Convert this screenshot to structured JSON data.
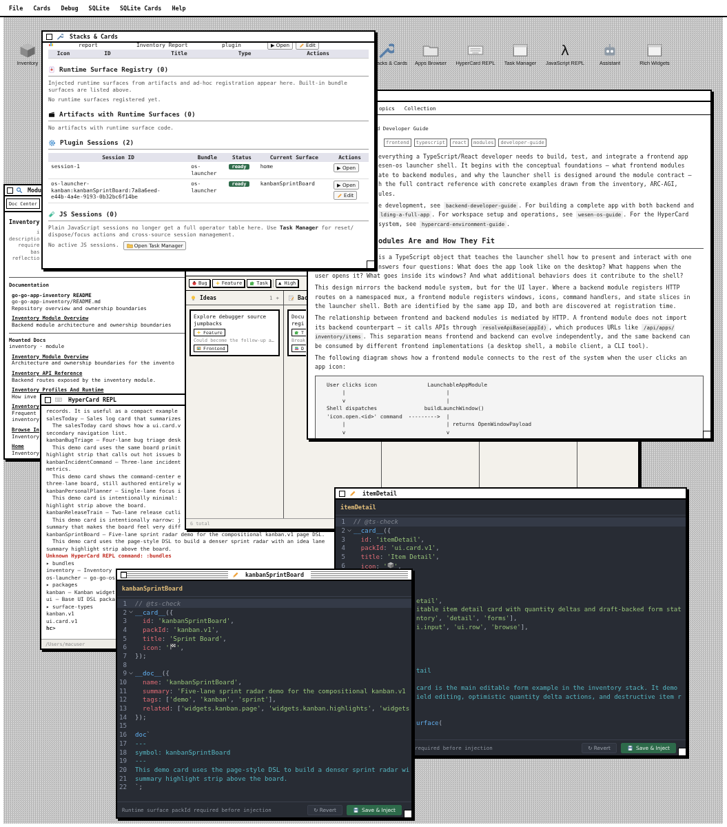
{
  "menu_bar": [
    {
      "label": "File"
    },
    {
      "label": "Cards"
    },
    {
      "label": "Debug"
    },
    {
      "label": "SQLite"
    },
    {
      "label": "SQLite Cards"
    },
    {
      "label": "Help"
    }
  ],
  "desktop_icons": [
    {
      "label": "Inventory",
      "kind": "box"
    },
    {
      "label": "acks & Cards",
      "kind": "wrench"
    },
    {
      "label": "Apps Browser",
      "kind": "folder"
    },
    {
      "label": "HyperCard REPL",
      "kind": "keyboard"
    },
    {
      "label": "Task Manager",
      "kind": "window"
    },
    {
      "label": "JavaScript REPL",
      "kind": "glyph",
      "glyph": "λ"
    },
    {
      "label": "Assistant",
      "kind": "robot"
    },
    {
      "label": "Rich Widgets",
      "kind": "window"
    }
  ],
  "module_window": {
    "title": "Modu",
    "active": false,
    "search": "Doc Center",
    "heading": "Inventory",
    "summary": "i\ndescriptio\nrequire\nbas\nreflectio",
    "sections": [
      {
        "title": "Documentation",
        "entries": [
          {
            "title": "go-go-app-inventory README",
            "link": false,
            "path": "go-go-app-inventory/README.md",
            "desc": "Repository overview and ownership boundaries"
          },
          {
            "title": "Inventory Module Overview",
            "link": true,
            "desc": "Backend module architecture and ownership boundaries"
          }
        ]
      },
      {
        "title": "Mounted Docs",
        "subtitle": "inventory · module",
        "entries": [
          {
            "title": "Inventory Module Overview",
            "link": true,
            "desc": "Architecture and ownership boundaries for the invento"
          },
          {
            "title": "Inventory API Reference",
            "link": true,
            "desc": "Backend routes exposed by the inventory module."
          },
          {
            "title": "Inventory Profiles And Runtime",
            "link": true,
            "desc": "How inve"
          },
          {
            "title": "Inventory",
            "link": true,
            "desc": "Frequent\ninventory"
          },
          {
            "title": "Browse In",
            "link": true,
            "desc": "Inventory"
          },
          {
            "title": "Home",
            "link": true,
            "desc": "Inventory"
          }
        ]
      }
    ]
  },
  "repl_window": {
    "title": "HyperCard REPL",
    "active": false,
    "lines": [
      {
        "kind": "text",
        "text": "records. It is useful as a compact example"
      },
      {
        "kind": "text",
        "text": "salesToday — Sales log card that summarizes"
      },
      {
        "kind": "text",
        "text": "  The salesToday card shows how a ui.card.v"
      },
      {
        "kind": "text",
        "text": "secondary navigation list."
      },
      {
        "kind": "text",
        "text": "kanbanBugTriage — Four-lane bug triage desk"
      },
      {
        "kind": "text",
        "text": "  This demo card uses the same board primit"
      },
      {
        "kind": "text",
        "text": "highlight strip that calls out hot issues b"
      },
      {
        "kind": "text",
        "text": "kanbanIncidentCommand — Three-lane incident"
      },
      {
        "kind": "text",
        "text": "metrics."
      },
      {
        "kind": "text",
        "text": "  This demo card shows the command-center e"
      },
      {
        "kind": "text",
        "text": "three-lane board, still authored entirely w"
      },
      {
        "kind": "text",
        "text": "kanbanPersonalPlanner — Single-lane focus i"
      },
      {
        "kind": "text",
        "text": "  This demo card is intentionally minimal:"
      },
      {
        "kind": "text",
        "text": "highlight strip above the board."
      },
      {
        "kind": "text",
        "text": "kanbanReleaseTrain — Two-lane release cutli"
      },
      {
        "kind": "text",
        "text": "  This demo card is intentionally narrow: j"
      },
      {
        "kind": "text",
        "text": "summary that makes the board feel very diff"
      },
      {
        "kind": "text",
        "text": "kanbanSprintBoard — Five-lane sprint radar demo for the compositional kanban.v1 page DSL."
      },
      {
        "kind": "text",
        "text": "  This demo card uses the page-style DSL to build a denser sprint radar with an idea lane"
      },
      {
        "kind": "text",
        "text": "summary highlight strip above the board."
      },
      {
        "kind": "error",
        "text": "Unknown HyperCard REPL command: :bundles"
      },
      {
        "kind": "text",
        "text": "▸ bundles"
      },
      {
        "kind": "text",
        "text": "inventory — Inventory"
      },
      {
        "kind": "text",
        "text": "os-launcher — go-go-os"
      },
      {
        "kind": "text",
        "text": "▸ packages"
      },
      {
        "kind": "text",
        "text": "kanban — Kanban widget"
      },
      {
        "kind": "text",
        "text": "ui — Base UI DSL packa"
      },
      {
        "kind": "text",
        "text": "▸ surface-types"
      },
      {
        "kind": "text",
        "text": "kanban.v1"
      },
      {
        "kind": "text",
        "text": "ui.card.v1"
      },
      {
        "kind": "prompt",
        "text": "hc>"
      }
    ],
    "footer": "/Users/macuser"
  },
  "kanban_window": {
    "filters": [
      {
        "label": "Bug",
        "kind": "bug"
      },
      {
        "label": "Feature",
        "kind": "sparkle"
      },
      {
        "label": "Task",
        "kind": "puzzle"
      },
      {
        "label": "▲ High",
        "kind": "text"
      }
    ],
    "lanes": [
      {
        "title": "Ideas",
        "kind": "bulb",
        "count": "1",
        "add": "+",
        "cards": [
          {
            "title": "Explore debugger source jumpbacks",
            "tags": [
              {
                "label": "Feature",
                "kind": "sparkle"
              }
            ],
            "note": "Could become the follow-up a…",
            "extra_tags": [
              {
                "label": "Frontend",
                "kind": "frame"
              }
            ]
          }
        ]
      },
      {
        "title": "Bac",
        "kind": "notepad",
        "cards": [
          {
            "title": "Docu\nregi",
            "tags": [
              {
                "label": "T",
                "kind": "puzzle"
              }
            ],
            "note": "Break",
            "extra_tags": [
              {
                "label": "D",
                "kind": "books"
              }
            ]
          }
        ]
      }
    ],
    "footer": "6 total"
  },
  "doc_window": {
    "active": false,
    "tabs": [
      {
        "label": "opics",
        "selected": false
      },
      {
        "label": "Collection",
        "selected": false
      }
    ],
    "subtitle": "d Developer Guide",
    "tags": [
      "frontend",
      "typescript",
      "react",
      "modules",
      "developer-guide"
    ],
    "upper": [
      [
        {
          "kind": "text",
          "text": "everything a TypeScript/React developer needs to build, test, and integrate a frontend app\nesen-os launcher shell. It begins with the conceptual foundations — what frontend modules\nate to backend modules, and why the launcher shell is designed around the module contract —\nh the full contract reference with concrete examples drawn from the inventory, ARC-AGI,\nules."
        }
      ],
      [
        {
          "kind": "text",
          "text": "e development, see "
        },
        {
          "kind": "code",
          "text": "backend-developer-guide"
        },
        {
          "kind": "text",
          "text": ". For building a complete app with both backend and\n"
        },
        {
          "kind": "code",
          "text": "lding-a-full-app"
        },
        {
          "kind": "text",
          "text": ". For workspace setup and operations, see "
        },
        {
          "kind": "code",
          "text": "wesen-os-guide"
        },
        {
          "kind": "text",
          "text": ". For the HyperCard\nsystem, see "
        },
        {
          "kind": "code",
          "text": "hypercard-environment-guide"
        },
        {
          "kind": "text",
          "text": "."
        }
      ]
    ],
    "heading": "odules Are and How They Fit",
    "upper_after": [
      [
        {
          "kind": "text",
          "text": "is a TypeScript object that teaches the launcher shell how to present and interact with one\nnswers four questions: What does the app look like on the desktop? What happens when the"
        }
      ]
    ],
    "lower": [
      [
        {
          "kind": "text",
          "text": "user opens it? What goes inside its windows? And what additional behaviors does it contribute to the shell?"
        }
      ],
      [
        {
          "kind": "text",
          "text": "This design mirrors the backend module system, but for the UI layer. Where a backend module registers HTTP\nroutes on a namespaced mux, a frontend module registers windows, icons, command handlers, and state slices in\nthe launcher shell. Both are identified by the same app ID, and both are discovered at registration time."
        }
      ],
      [
        {
          "kind": "text",
          "text": "The relationship between frontend and backend modules is mediated by HTTP. A frontend module does not import\nits backend counterpart — it calls APIs through "
        },
        {
          "kind": "code",
          "text": "resolveApiBase(appId)"
        },
        {
          "kind": "text",
          "text": ", which produces URLs like "
        },
        {
          "kind": "code",
          "text": "/api/apps/\ninventory/items"
        },
        {
          "kind": "text",
          "text": ". This separation means frontend and backend can evolve independently, and the same backend can\nbe consumed by different frontend implementations (a desktop shell, a mobile client, a CLI tool)."
        }
      ],
      [
        {
          "kind": "text",
          "text": "The following diagram shows how a frontend module connects to the rest of the system when the user clicks an\napp icon:"
        }
      ]
    ],
    "diagram": "User clicks icon                LaunchableAppModule\n     |                                |\n     v                                |\nShell dispatches               buildLaunchWindow()\n'icon.open.<id>' command  --------->  |\n     |                                | returns OpenWindowPayload\n     v                                v"
  },
  "stacks_window": {
    "title": "Stacks & Cards",
    "active": false,
    "partial_row": {
      "cells": [
        "report",
        "Inventory Report",
        "plugin"
      ],
      "actions": [
        {
          "label": "▶ Open",
          "kind": "open"
        },
        {
          "label": "Edit",
          "kind": "edit"
        }
      ]
    },
    "columns": [
      "Icon",
      "ID",
      "Title",
      "Type",
      "Actions"
    ],
    "registry": {
      "title": "Runtime Surface Registry (0)",
      "desc": "Injected runtime surfaces from artifacts and ad-hoc registration appear here. Built-in bundle surfaces are listed above.",
      "empty": "No runtime surfaces registered yet."
    },
    "artifacts": {
      "title": "Artifacts with Runtime Surfaces (0)",
      "empty": "No artifacts with runtime surface code."
    },
    "plugin_sessions": {
      "title": "Plugin Sessions (2)",
      "columns": [
        "Session ID",
        "Bundle",
        "Status",
        "Current Surface",
        "Actions"
      ],
      "rows": [
        {
          "session_id": "session-1",
          "bundle": "os-\nlauncher",
          "status": "ready",
          "surface": "home",
          "actions": [
            {
              "label": "▶ Open",
              "kind": "open"
            }
          ]
        },
        {
          "session_id": "os-launcher-\nkanban:kanbanSprintBoard:7a8a6eed-\ne44b-4a4e-9193-0b32bc6f14be",
          "bundle": "os-\nlauncher",
          "status": "ready",
          "surface": "kanbanSprintBoard",
          "actions": [
            {
              "label": "▶ Open",
              "kind": "open"
            },
            {
              "label": "Edit",
              "kind": "edit"
            }
          ]
        }
      ]
    },
    "js_sessions": {
      "title": "JS Sessions (0)",
      "desc": "Plain JavaScript sessions no longer get a full operator table here. Use **Task Manager** for reset/\ndispose/focus actions and cross-source session management.",
      "empty": "No active JS sessions.",
      "button": "Open Task Manager"
    }
  },
  "item_window": {
    "title": "itemDetail",
    "active": false,
    "header": "itemDetail",
    "lines": [
      {
        "n": "1",
        "active": true,
        "tokens": [
          {
            "kind": "comment",
            "text": "// @ts-check"
          }
        ]
      },
      {
        "n": "2",
        "fold": true,
        "tokens": [
          {
            "kind": "func",
            "text": "__card__"
          },
          {
            "kind": "punct",
            "text": "({"
          }
        ]
      },
      {
        "n": "3",
        "tokens": [
          {
            "kind": "key",
            "text": "  id"
          },
          {
            "kind": "punct",
            "text": ": "
          },
          {
            "kind": "string",
            "text": "'itemDetail'"
          },
          {
            "kind": "punct",
            "text": ","
          }
        ]
      },
      {
        "n": "4",
        "tokens": [
          {
            "kind": "key",
            "text": "  packId"
          },
          {
            "kind": "punct",
            "text": ": "
          },
          {
            "kind": "string",
            "text": "'ui.card.v1'"
          },
          {
            "kind": "punct",
            "text": ","
          }
        ]
      },
      {
        "n": "5",
        "tokens": [
          {
            "kind": "key",
            "text": "  title"
          },
          {
            "kind": "punct",
            "text": ": "
          },
          {
            "kind": "string",
            "text": "'Item Detail'"
          },
          {
            "kind": "punct",
            "text": ","
          }
        ]
      },
      {
        "n": "6",
        "tokens": [
          {
            "kind": "key",
            "text": "  icon"
          },
          {
            "kind": "punct",
            "text": ": "
          },
          {
            "kind": "string",
            "text": "'"
          },
          {
            "kind": "box"
          },
          {
            "kind": "string",
            "text": "'"
          },
          {
            "kind": "punct",
            "text": ","
          }
        ]
      },
      {
        "kind": "blank"
      },
      {
        "kind": "blank"
      },
      {
        "kind": "blank"
      },
      {
        "kind": "fragment",
        "tokens": [
          {
            "kind": "string",
            "text": "etail'"
          },
          {
            "kind": "punct",
            "text": ","
          }
        ]
      },
      {
        "kind": "fragment",
        "tokens": [
          {
            "kind": "string",
            "text": "itable item detail card with quantity deltas and draft-backed form stat"
          }
        ]
      },
      {
        "kind": "fragment",
        "tokens": [
          {
            "kind": "string",
            "text": "ntory'"
          },
          {
            "kind": "punct",
            "text": ", "
          },
          {
            "kind": "string",
            "text": "'detail'"
          },
          {
            "kind": "punct",
            "text": ", "
          },
          {
            "kind": "string",
            "text": "'forms'"
          },
          {
            "kind": "punct",
            "text": "],"
          }
        ]
      },
      {
        "kind": "fragment",
        "tokens": [
          {
            "kind": "string",
            "text": "i.input'"
          },
          {
            "kind": "punct",
            "text": ", "
          },
          {
            "kind": "string",
            "text": "'ui.row'"
          },
          {
            "kind": "punct",
            "text": ", "
          },
          {
            "kind": "string",
            "text": "'browse'"
          },
          {
            "kind": "punct",
            "text": "],"
          }
        ]
      },
      {
        "kind": "blank"
      },
      {
        "kind": "blank"
      },
      {
        "kind": "blank"
      },
      {
        "kind": "blank"
      },
      {
        "kind": "fragment",
        "tokens": [
          {
            "kind": "doc",
            "text": "tail"
          }
        ]
      },
      {
        "kind": "blank"
      },
      {
        "kind": "fragment",
        "tokens": [
          {
            "kind": "doc",
            "text": "card is the main editable form example in the inventory stack. It demo"
          }
        ]
      },
      {
        "kind": "fragment",
        "tokens": [
          {
            "kind": "doc",
            "text": "ield editing, optimistic quantity delta actions, and destructive item r"
          }
        ]
      },
      {
        "kind": "blank"
      },
      {
        "kind": "blank"
      },
      {
        "kind": "fragment",
        "tokens": [
          {
            "kind": "func",
            "text": "urface"
          },
          {
            "kind": "punct",
            "text": "("
          }
        ]
      }
    ],
    "footer": "required before injection",
    "buttons": [
      {
        "label": "↻ Revert",
        "kind": "secondary"
      },
      {
        "label": "Save & Inject",
        "kind": "primary"
      }
    ]
  },
  "sprint_window": {
    "title": "kanbanSprintBoard",
    "active": true,
    "header": "kanbanSprintBoard",
    "lines": [
      {
        "n": "1",
        "active": true,
        "tokens": [
          {
            "kind": "comment",
            "text": "// @ts-check"
          }
        ]
      },
      {
        "n": "2",
        "fold": true,
        "tokens": [
          {
            "kind": "func",
            "text": "__card__"
          },
          {
            "kind": "punct",
            "text": "({"
          }
        ]
      },
      {
        "n": "3",
        "tokens": [
          {
            "kind": "key",
            "text": "  id"
          },
          {
            "kind": "punct",
            "text": ": "
          },
          {
            "kind": "string",
            "text": "'kanbanSprintBoard'"
          },
          {
            "kind": "punct",
            "text": ","
          }
        ]
      },
      {
        "n": "4",
        "tokens": [
          {
            "kind": "key",
            "text": "  packId"
          },
          {
            "kind": "punct",
            "text": ": "
          },
          {
            "kind": "string",
            "text": "'kanban.v1'"
          },
          {
            "kind": "punct",
            "text": ","
          }
        ]
      },
      {
        "n": "5",
        "tokens": [
          {
            "kind": "key",
            "text": "  title"
          },
          {
            "kind": "punct",
            "text": ": "
          },
          {
            "kind": "string",
            "text": "'Sprint Board'"
          },
          {
            "kind": "punct",
            "text": ","
          }
        ]
      },
      {
        "n": "6",
        "tokens": [
          {
            "kind": "key",
            "text": "  icon"
          },
          {
            "kind": "punct",
            "text": ": "
          },
          {
            "kind": "string",
            "text": "'"
          },
          {
            "kind": "flag"
          },
          {
            "kind": "string",
            "text": "'"
          },
          {
            "kind": "punct",
            "text": ","
          }
        ]
      },
      {
        "n": "7",
        "tokens": [
          {
            "kind": "punct",
            "text": "});"
          }
        ]
      },
      {
        "n": "8"
      },
      {
        "n": "9",
        "fold": true,
        "tokens": [
          {
            "kind": "func",
            "text": "__doc__"
          },
          {
            "kind": "punct",
            "text": "({"
          }
        ]
      },
      {
        "n": "10",
        "tokens": [
          {
            "kind": "key",
            "text": "  name"
          },
          {
            "kind": "punct",
            "text": ": "
          },
          {
            "kind": "string",
            "text": "'kanbanSprintBoard'"
          },
          {
            "kind": "punct",
            "text": ","
          }
        ]
      },
      {
        "n": "11",
        "tokens": [
          {
            "kind": "key",
            "text": "  summary"
          },
          {
            "kind": "punct",
            "text": ": "
          },
          {
            "kind": "string",
            "text": "'Five-lane sprint radar demo for the compositional kanban.v1"
          }
        ]
      },
      {
        "n": "12",
        "tokens": [
          {
            "kind": "key",
            "text": "  tags"
          },
          {
            "kind": "punct",
            "text": ": ["
          },
          {
            "kind": "string",
            "text": "'demo'"
          },
          {
            "kind": "punct",
            "text": ", "
          },
          {
            "kind": "string",
            "text": "'kanban'"
          },
          {
            "kind": "punct",
            "text": ", "
          },
          {
            "kind": "string",
            "text": "'sprint'"
          },
          {
            "kind": "punct",
            "text": "],"
          }
        ]
      },
      {
        "n": "13",
        "tokens": [
          {
            "kind": "key",
            "text": "  related"
          },
          {
            "kind": "punct",
            "text": ": ["
          },
          {
            "kind": "string",
            "text": "'widgets.kanban.page'"
          },
          {
            "kind": "punct",
            "text": ", "
          },
          {
            "kind": "string",
            "text": "'widgets.kanban.highlights'"
          },
          {
            "kind": "punct",
            "text": ", "
          },
          {
            "kind": "string",
            "text": "'widgets"
          }
        ]
      },
      {
        "n": "14",
        "tokens": [
          {
            "kind": "punct",
            "text": "});"
          }
        ]
      },
      {
        "n": "15"
      },
      {
        "n": "16",
        "tokens": [
          {
            "kind": "func",
            "text": "doc"
          },
          {
            "kind": "punct",
            "text": "`"
          }
        ]
      },
      {
        "n": "17",
        "tokens": [
          {
            "kind": "doc",
            "text": "---"
          }
        ]
      },
      {
        "n": "18",
        "tokens": [
          {
            "kind": "doc",
            "text": "symbol: kanbanSprintBoard"
          }
        ]
      },
      {
        "n": "19",
        "tokens": [
          {
            "kind": "doc",
            "text": "---"
          }
        ]
      },
      {
        "n": "20",
        "tokens": [
          {
            "kind": "doc",
            "text": "This demo card uses the page-style DSL to build a denser sprint radar wi"
          }
        ]
      },
      {
        "n": "21",
        "tokens": [
          {
            "kind": "doc",
            "text": "summary highlight strip above the board."
          }
        ]
      },
      {
        "n": "22",
        "tokens": [
          {
            "kind": "punct",
            "text": "`;"
          }
        ]
      }
    ],
    "footer": "Runtime surface packId required before injection",
    "buttons": [
      {
        "label": "↻ Revert",
        "kind": "secondary"
      },
      {
        "label": "Save & Inject",
        "kind": "primary"
      }
    ]
  }
}
